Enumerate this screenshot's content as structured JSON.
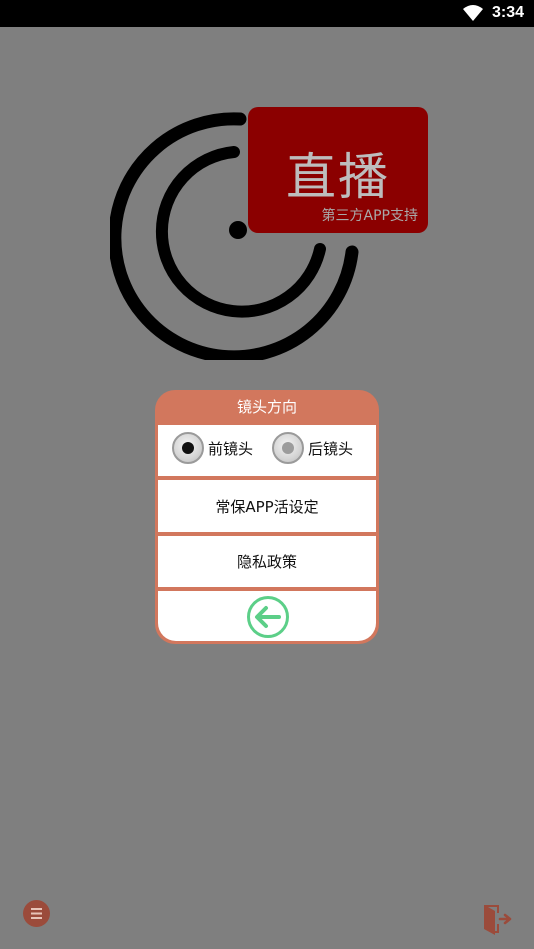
{
  "status_bar": {
    "time": "3:34"
  },
  "logo": {
    "badge_title": "直播",
    "badge_subtitle": "第三方APP支持"
  },
  "dialog": {
    "title": "镜头方向",
    "radio_front_label": "前镜头",
    "radio_back_label": "后镜头",
    "selected": "front",
    "keep_alive_label": "常保APP活设定",
    "privacy_label": "隐私政策"
  },
  "colors": {
    "background": "#7f7f7f",
    "dialog_accent": "#d2775d",
    "badge": "#8b0000",
    "back_arrow": "#5ccf88",
    "menu_button": "#9b4b3b"
  },
  "icons": {
    "back": "arrow-left-circle-icon",
    "menu": "menu-icon",
    "exit": "exit-door-icon",
    "wifi": "wifi-icon"
  }
}
